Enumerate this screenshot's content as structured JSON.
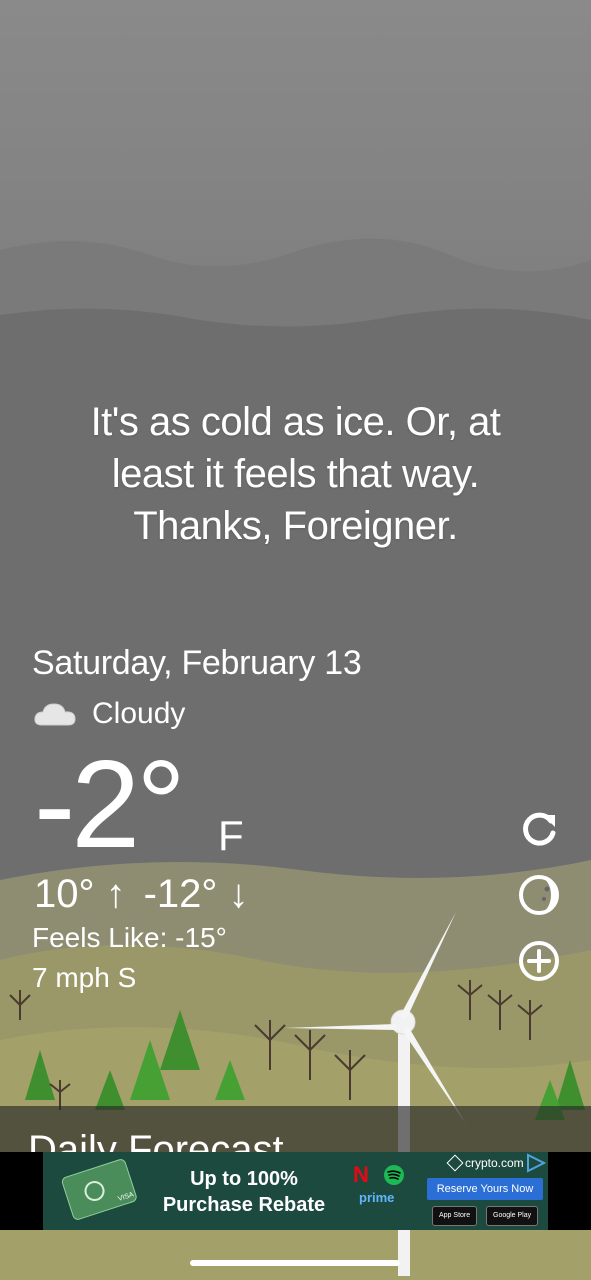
{
  "quote": {
    "line1": "It's as cold as ice. Or, at",
    "line2": "least it feels that way.",
    "line3": "Thanks, Foreigner."
  },
  "weather": {
    "date": "Saturday, February 13",
    "condition": "Cloudy",
    "condition_icon": "cloud-icon",
    "temperature": "-2°",
    "unit": "F",
    "high": "10° ↑",
    "low": "-12° ↓",
    "feels_like": "Feels Like: -15°",
    "wind": "7 mph S"
  },
  "actions": {
    "refresh_icon": "refresh-icon",
    "moon_icon": "moon-phase-icon",
    "add_icon": "add-location-icon"
  },
  "forecast": {
    "title": "Daily Forecast"
  },
  "ad": {
    "headline_line1": "Up to 100%",
    "headline_line2": "Purchase Rebate",
    "brand": "crypto.com",
    "cta": "Reserve Yours Now",
    "app_store": "App Store",
    "google_play": "Google Play",
    "prime": "prime",
    "card_label": "VISA"
  },
  "colors": {
    "sky": "#6f6f6f",
    "hill_far": "#8f8f6a",
    "hill_near": "#9c9b6a",
    "tree_green": "#3f8f2f",
    "ad_cta": "#2b6fd6"
  }
}
